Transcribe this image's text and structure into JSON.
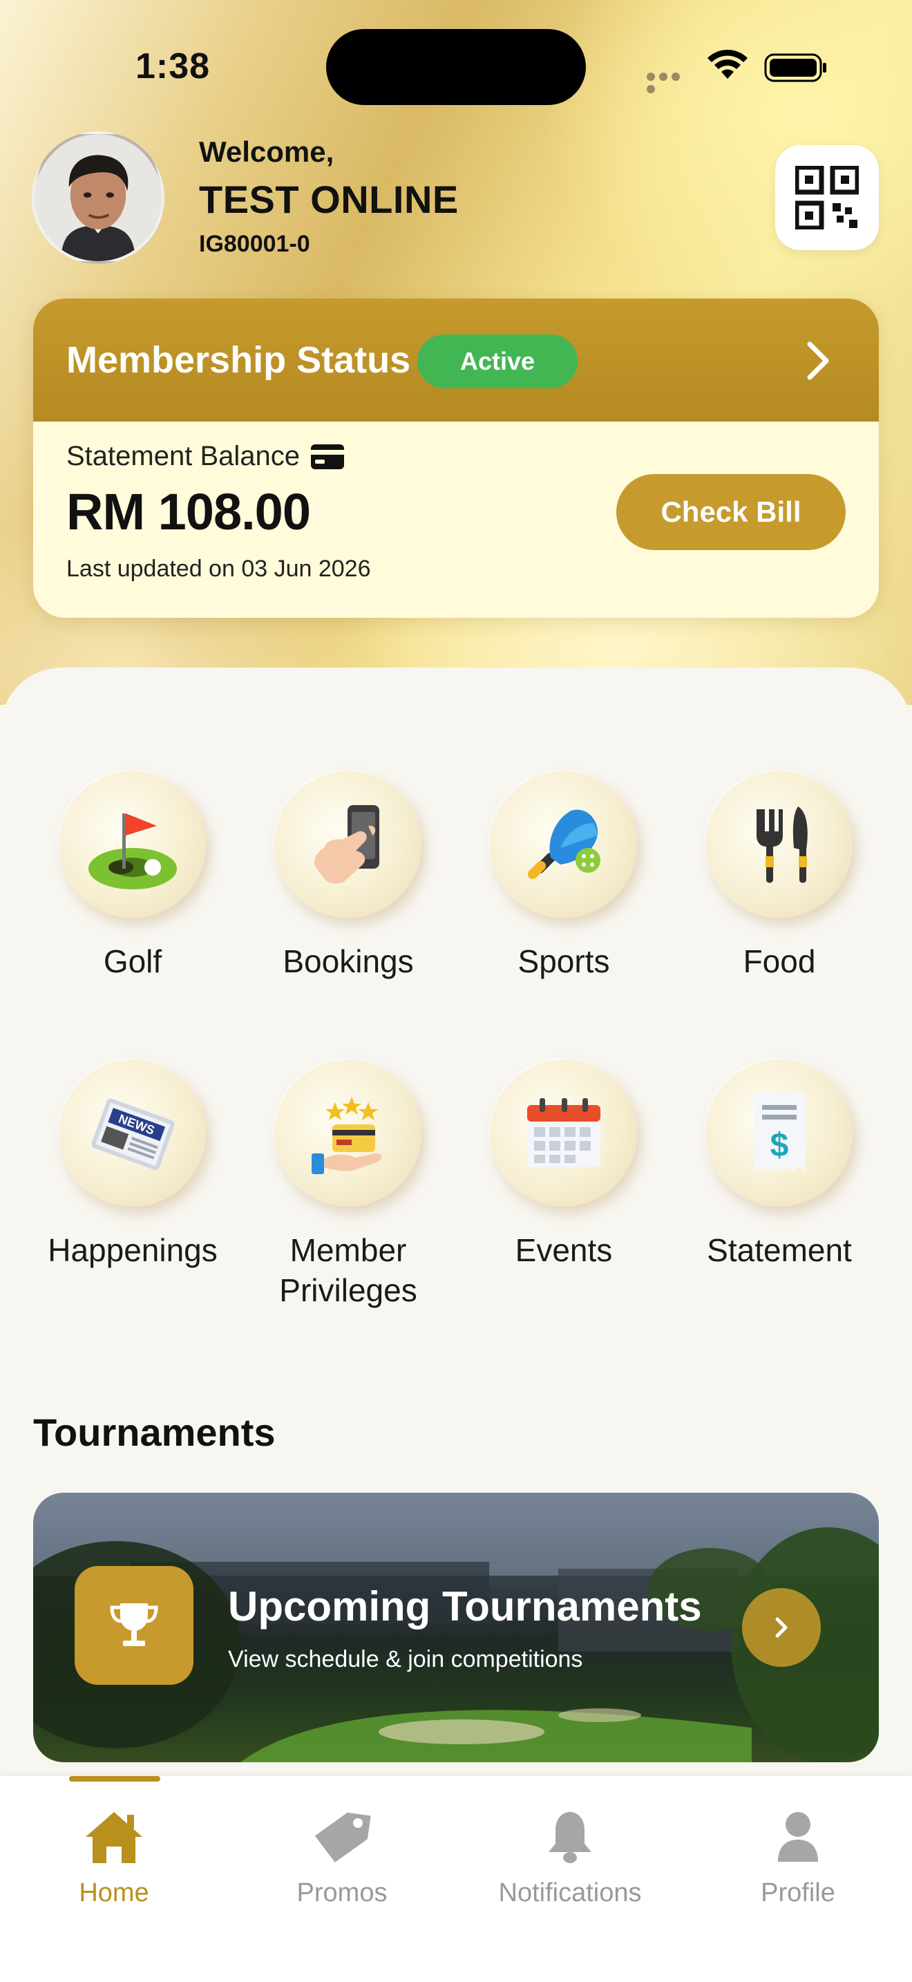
{
  "status_bar": {
    "time": "1:38"
  },
  "header": {
    "welcome": "Welcome,",
    "name": "TEST ONLINE",
    "member_id": "IG80001-0"
  },
  "membership": {
    "title": "Membership Status",
    "status": "Active",
    "balance_label": "Statement Balance",
    "balance": "RM 108.00",
    "last_updated": "Last updated on 03 Jun 2026",
    "check_bill": "Check Bill"
  },
  "services": [
    {
      "label": "Golf",
      "icon": "golf-icon"
    },
    {
      "label": "Bookings",
      "icon": "phone-booking-icon"
    },
    {
      "label": "Sports",
      "icon": "pickleball-icon"
    },
    {
      "label": "Food",
      "icon": "fork-knife-icon"
    },
    {
      "label": "Happenings",
      "icon": "newspaper-icon"
    },
    {
      "label": "Member\nPrivileges",
      "icon": "privileges-icon"
    },
    {
      "label": "Events",
      "icon": "calendar-icon"
    },
    {
      "label": "Statement",
      "icon": "receipt-icon"
    }
  ],
  "tournaments": {
    "section_title": "Tournaments",
    "card_title": "Upcoming Tournaments",
    "card_subtitle": "View schedule & join competitions"
  },
  "nav": {
    "items": [
      {
        "label": "Home",
        "icon": "home-icon",
        "active": true
      },
      {
        "label": "Promos",
        "icon": "tag-icon",
        "active": false
      },
      {
        "label": "Notifications",
        "icon": "bell-icon",
        "active": false
      },
      {
        "label": "Profile",
        "icon": "person-icon",
        "active": false
      }
    ]
  },
  "colors": {
    "gold": "#c69a2c",
    "active_green": "#43b654",
    "nav_active": "#b8901e",
    "nav_inactive": "#999999"
  }
}
